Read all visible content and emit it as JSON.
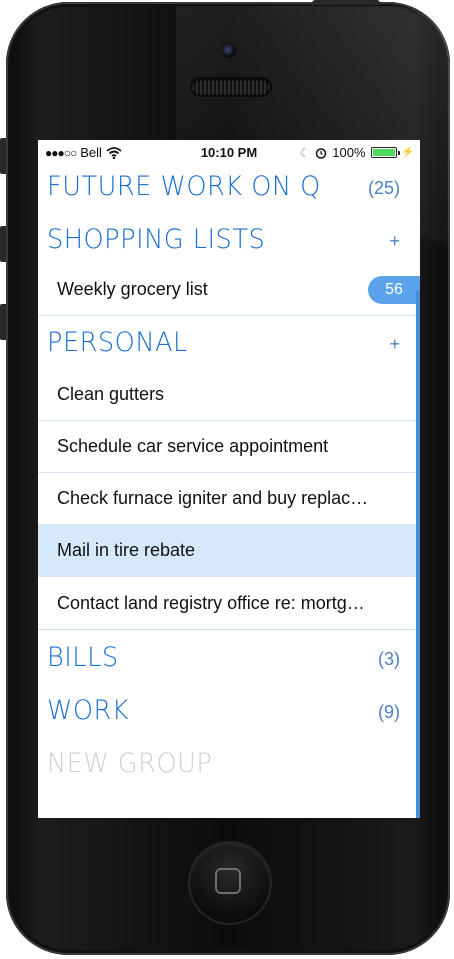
{
  "status_bar": {
    "signal": "●●●○○",
    "carrier": "Bell",
    "time": "10:10 PM",
    "battery": "100%",
    "battery_level": 1.0
  },
  "groups": [
    {
      "title": "FUTURE WORK ON Q",
      "right": "(25)"
    },
    {
      "title": "SHOPPING LISTS",
      "right": "+"
    },
    {
      "title": "PERSONAL",
      "right": "+"
    },
    {
      "title": "BILLS",
      "right": "(3)"
    },
    {
      "title": "WORK",
      "right": "(9)"
    },
    {
      "title": "NEW GROUP"
    }
  ],
  "shopping_items": [
    {
      "text": "Weekly grocery list",
      "badge": "56"
    }
  ],
  "personal_items": [
    {
      "text": "Clean gutters"
    },
    {
      "text": "Schedule car service appointment"
    },
    {
      "text": "Check furnace igniter and buy replac…"
    },
    {
      "text": "Mail in tire rebate"
    },
    {
      "text": "Contact land registry office re: mortg…"
    }
  ],
  "colors": {
    "accent": "#1a6fd1",
    "badge": "#5ba4ec",
    "selected_row": "#d6e9fb",
    "muted": "#cfcfcf"
  },
  "icons": [
    "wifi-icon",
    "moon-icon",
    "alarm-icon",
    "battery-icon",
    "charging-icon",
    "home-button-icon"
  ]
}
